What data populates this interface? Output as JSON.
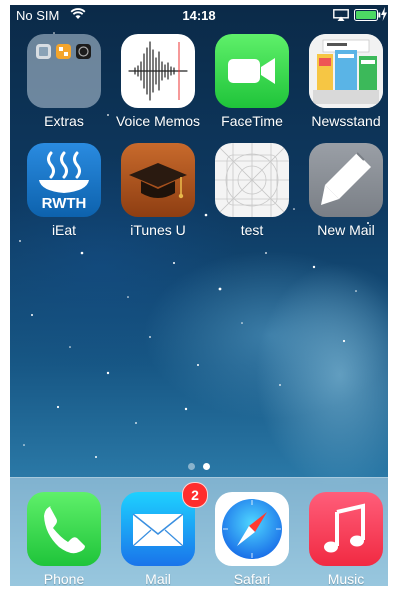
{
  "status_bar": {
    "carrier": "No SIM",
    "time": "14:18",
    "battery_color": "#4cd964"
  },
  "home_grid": [
    {
      "label": "Extras",
      "icon": "folder-icon"
    },
    {
      "label": "Voice Memos",
      "icon": "voice-memos-icon"
    },
    {
      "label": "FaceTime",
      "icon": "facetime-icon"
    },
    {
      "label": "Newsstand",
      "icon": "newsstand-icon"
    },
    {
      "label": "iEat",
      "icon": "ieat-icon",
      "icon_text": "RWTH"
    },
    {
      "label": "iTunes U",
      "icon": "itunes-u-icon"
    },
    {
      "label": "test",
      "icon": "blank-app-icon"
    },
    {
      "label": "New Mail",
      "icon": "new-mail-icon"
    }
  ],
  "page_indicator": {
    "pages": 2,
    "current": 2
  },
  "dock": [
    {
      "label": "Phone",
      "icon": "phone-icon"
    },
    {
      "label": "Mail",
      "icon": "mail-icon",
      "badge": "2"
    },
    {
      "label": "Safari",
      "icon": "safari-icon"
    },
    {
      "label": "Music",
      "icon": "music-icon"
    }
  ],
  "colors": {
    "facetime": "#3ddc4a",
    "phone": "#2fd34c",
    "mail": "#1d8ef5",
    "music": "#fc3158",
    "ieat": "#1378c8",
    "itunes_u": "#b0531c",
    "badge": "#ff2d2d"
  }
}
